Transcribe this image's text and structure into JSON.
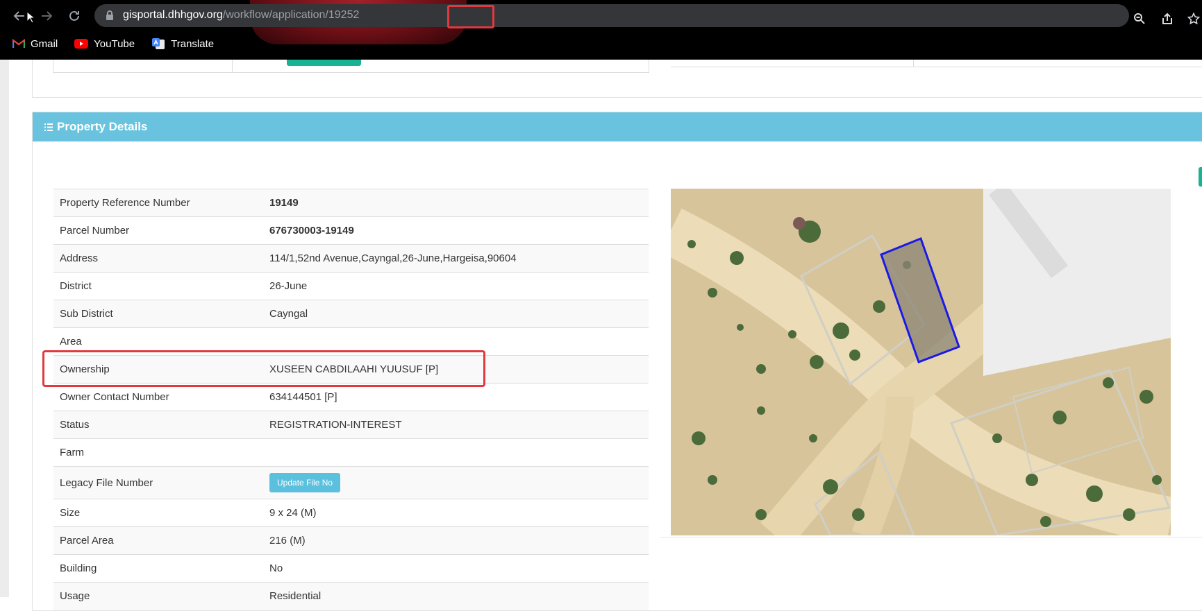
{
  "browser": {
    "url_host": "gisportal.dhhgov.org",
    "url_path": "/workflow/application/",
    "url_id": "19252",
    "bookmarks": [
      {
        "label": "Gmail"
      },
      {
        "label": "YouTube"
      },
      {
        "label": "Translate"
      }
    ]
  },
  "panel": {
    "title": "Property Details"
  },
  "details": {
    "rows": [
      {
        "label": "Property Reference Number",
        "value": "19149"
      },
      {
        "label": "Parcel Number",
        "value": "676730003-19149"
      },
      {
        "label": "Address",
        "value": "114/1,52nd Avenue,Cayngal,26-June,Hargeisa,90604"
      },
      {
        "label": "District",
        "value": "26-June"
      },
      {
        "label": "Sub District",
        "value": "Cayngal"
      },
      {
        "label": "Area",
        "value": ""
      },
      {
        "label": "Ownership",
        "value": "XUSEEN CABDILAAHI YUUSUF [P]"
      },
      {
        "label": "Owner Contact Number",
        "value": "634144501 [P]"
      },
      {
        "label": "Status",
        "value": "REGISTRATION-INTEREST"
      },
      {
        "label": "Farm",
        "value": ""
      },
      {
        "label": "Legacy File Number",
        "button": "Update File No"
      },
      {
        "label": "Size",
        "value": "9 x 24 (M)"
      },
      {
        "label": "Parcel Area",
        "value": "216 (M)"
      },
      {
        "label": "Building",
        "value": "No"
      },
      {
        "label": "Usage",
        "value": "Residential"
      }
    ]
  },
  "colors": {
    "panel_header": "#69c3df",
    "highlight": "#e0393e",
    "parcel_outline": "#1a1ae6",
    "button": "#5bc0de"
  }
}
